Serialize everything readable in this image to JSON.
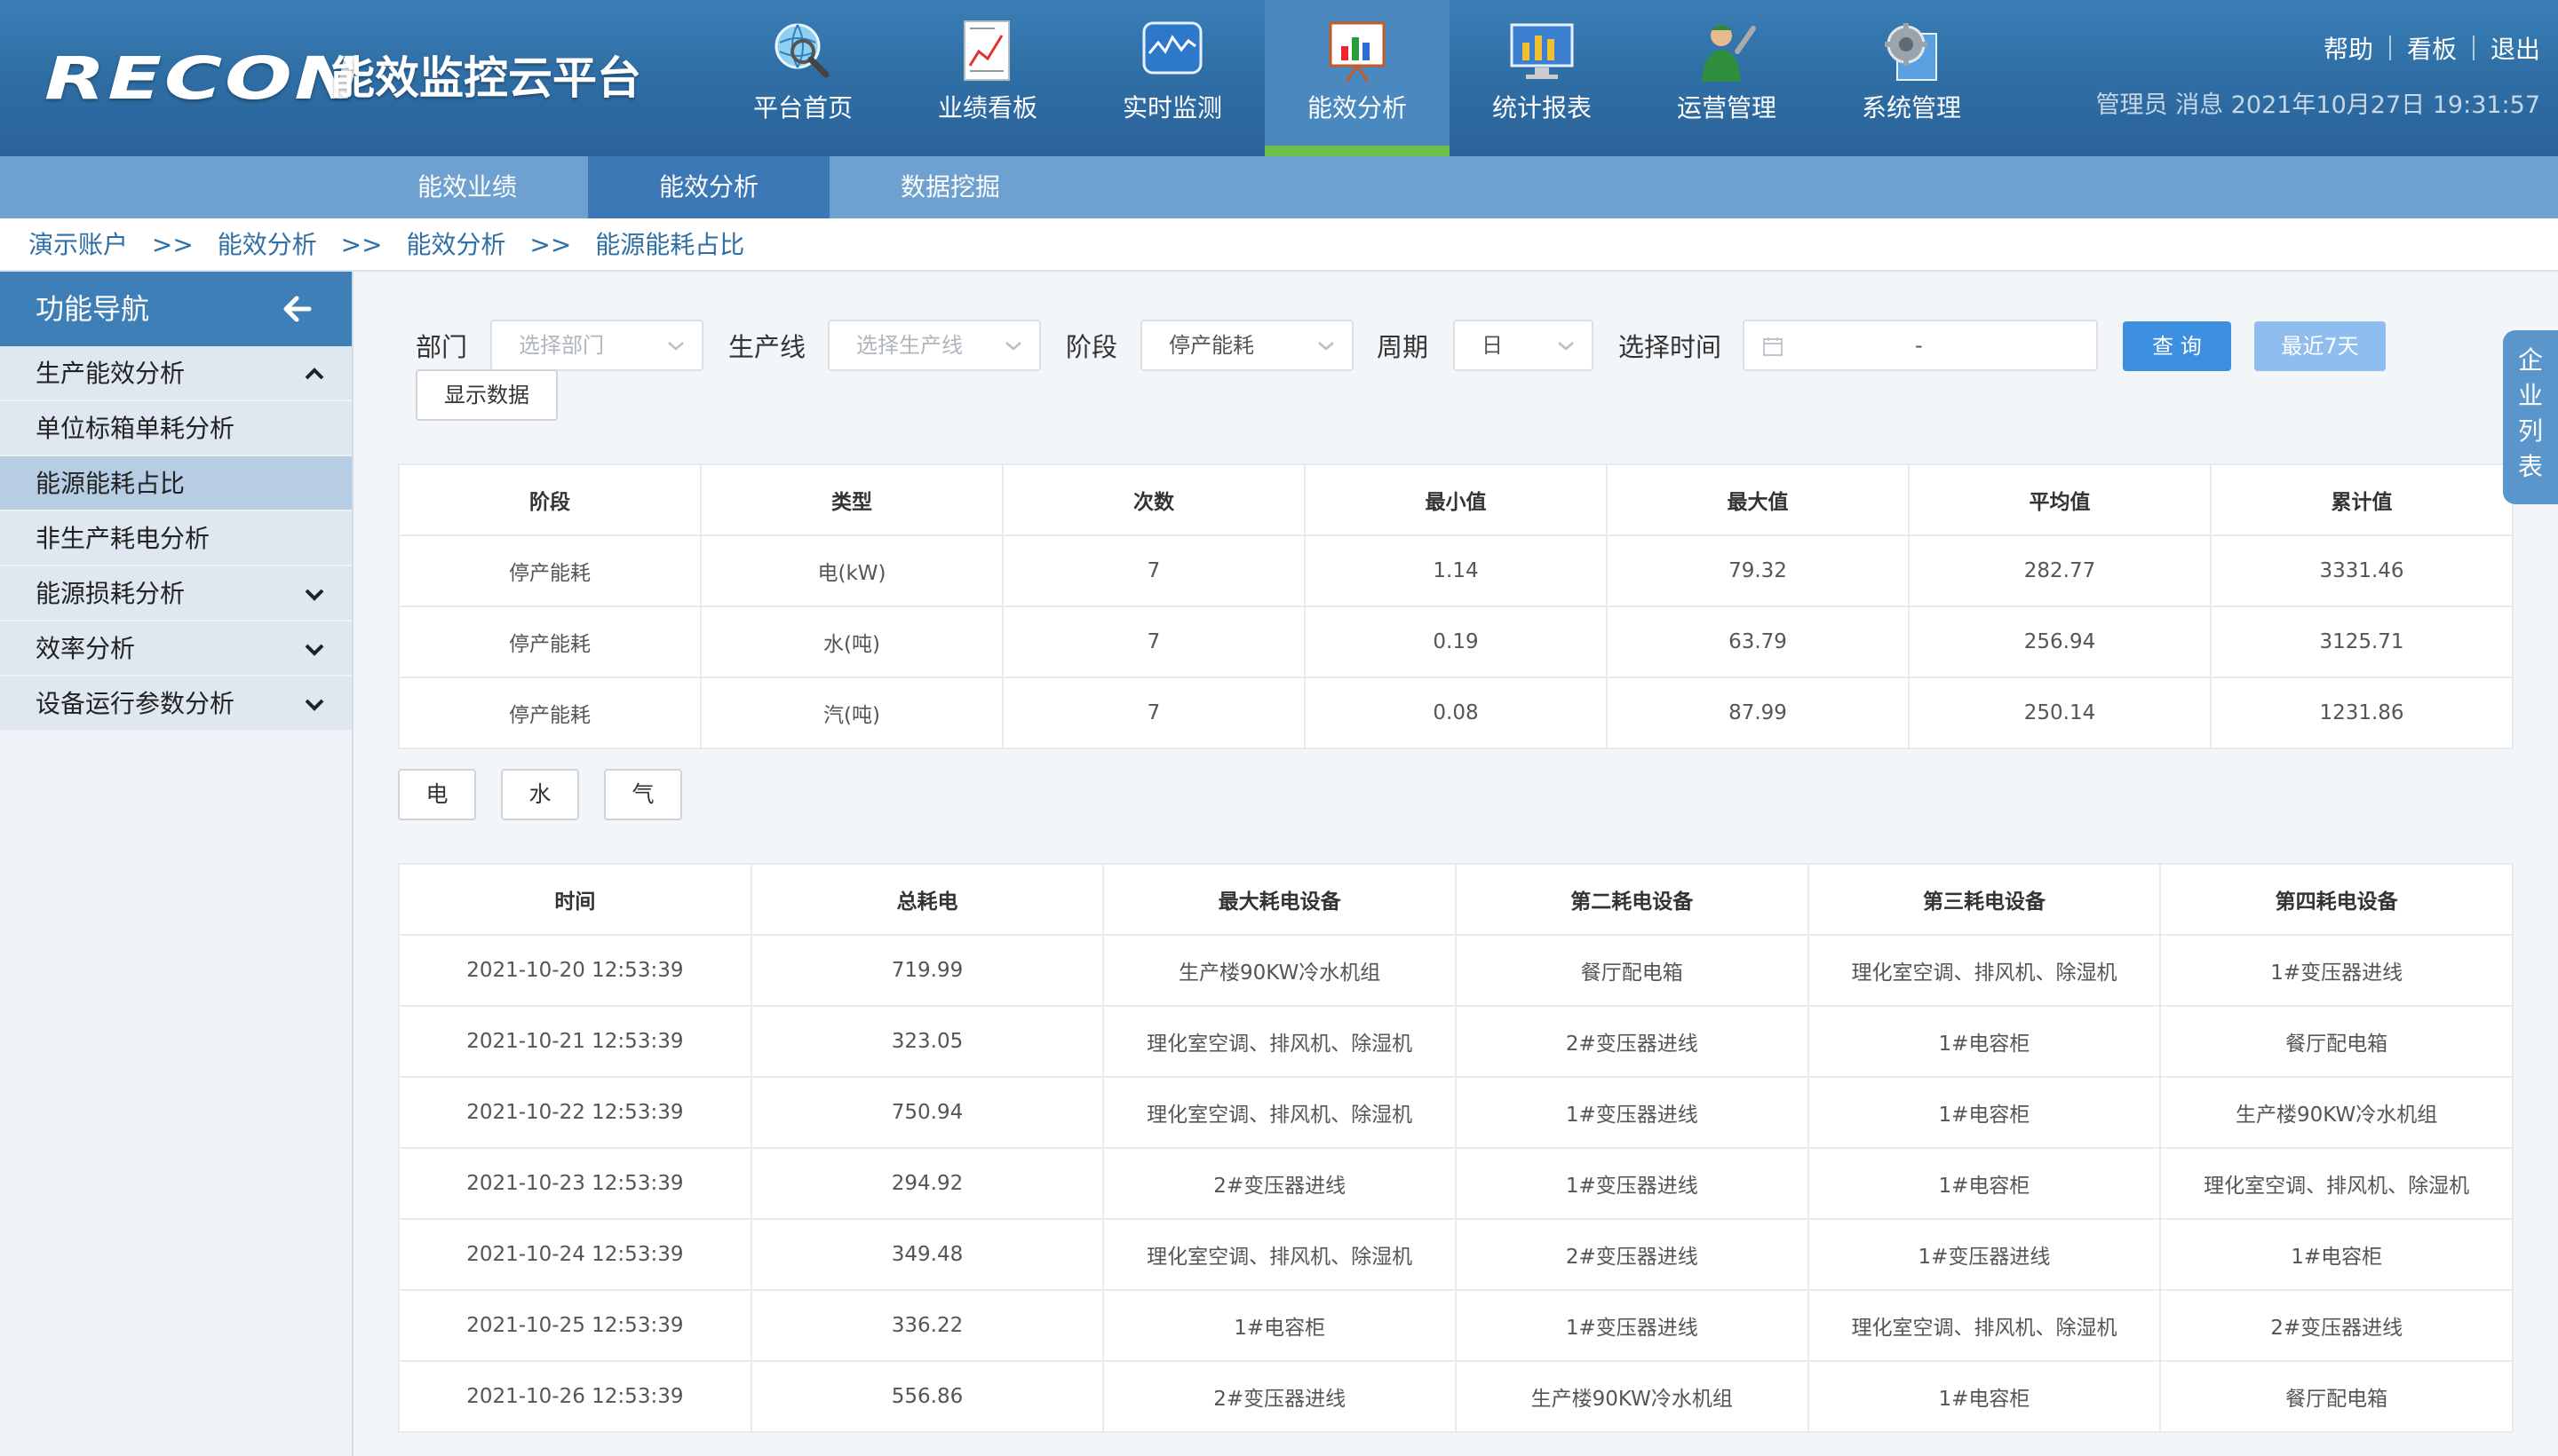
{
  "header": {
    "brand": "RECON",
    "platform": "能效监控云平台",
    "nav": [
      {
        "label": "平台首页",
        "icon": "globe-search-icon"
      },
      {
        "label": "业绩看板",
        "icon": "report-chart-icon"
      },
      {
        "label": "实时监测",
        "icon": "monitor-wave-icon"
      },
      {
        "label": "能效分析",
        "icon": "bar-chart-board-icon"
      },
      {
        "label": "统计报表",
        "icon": "screen-bar-icon"
      },
      {
        "label": "运营管理",
        "icon": "worker-wrench-icon"
      },
      {
        "label": "系统管理",
        "icon": "gear-document-icon"
      }
    ],
    "active_nav": "能效分析",
    "links": {
      "help": "帮助",
      "board": "看板",
      "logout": "退出"
    },
    "info": "管理员 消息 2021年10月27日 19:31:57"
  },
  "subnav": {
    "items": [
      "能效业绩",
      "能效分析",
      "数据挖掘"
    ],
    "active": "能效分析"
  },
  "breadcrumb": {
    "items": [
      "演示账户",
      "能效分析",
      "能效分析",
      "能源能耗占比"
    ],
    "separator": ">>"
  },
  "sidebar": {
    "title": "功能导航",
    "items": [
      {
        "label": "生产能效分析",
        "chevron": "up"
      },
      {
        "label": "单位标箱单耗分析"
      },
      {
        "label": "能源能耗占比",
        "active": true
      },
      {
        "label": "非生产耗电分析"
      },
      {
        "label": "能源损耗分析",
        "chevron": "down"
      },
      {
        "label": "效率分析",
        "chevron": "down"
      },
      {
        "label": "设备运行参数分析",
        "chevron": "down"
      }
    ]
  },
  "right_tab": "企业列表",
  "filters": {
    "department_label": "部门",
    "department_placeholder": "选择部门",
    "line_label": "生产线",
    "line_placeholder": "选择生产线",
    "stage_label": "阶段",
    "stage_value": "停产能耗",
    "period_label": "周期",
    "period_value": "日",
    "time_label": "选择时间",
    "time_separator": "-",
    "query_button": "查 询",
    "recent7_button": "最近7天",
    "show_data_button": "显示数据"
  },
  "summary_table": {
    "headers": [
      "阶段",
      "类型",
      "次数",
      "最小值",
      "最大值",
      "平均值",
      "累计值"
    ],
    "rows": [
      [
        "停产能耗",
        "电(kW)",
        "7",
        "1.14",
        "79.32",
        "282.77",
        "3331.46"
      ],
      [
        "停产能耗",
        "水(吨)",
        "7",
        "0.19",
        "63.79",
        "256.94",
        "3125.71"
      ],
      [
        "停产能耗",
        "汽(吨)",
        "7",
        "0.08",
        "87.99",
        "250.14",
        "1231.86"
      ]
    ]
  },
  "energy_tabs": [
    "电",
    "水",
    "气"
  ],
  "detail_table": {
    "headers": [
      "时间",
      "总耗电",
      "最大耗电设备",
      "第二耗电设备",
      "第三耗电设备",
      "第四耗电设备"
    ],
    "rows": [
      [
        "2021-10-20 12:53:39",
        "719.99",
        "生产楼90KW冷水机组",
        "餐厅配电箱",
        "理化室空调、排风机、除湿机",
        "1#变压器进线"
      ],
      [
        "2021-10-21 12:53:39",
        "323.05",
        "理化室空调、排风机、除湿机",
        "2#变压器进线",
        "1#电容柜",
        "餐厅配电箱"
      ],
      [
        "2021-10-22 12:53:39",
        "750.94",
        "理化室空调、排风机、除湿机",
        "1#变压器进线",
        "1#电容柜",
        "生产楼90KW冷水机组"
      ],
      [
        "2021-10-23 12:53:39",
        "294.92",
        "2#变压器进线",
        "1#变压器进线",
        "1#电容柜",
        "理化室空调、排风机、除湿机"
      ],
      [
        "2021-10-24 12:53:39",
        "349.48",
        "理化室空调、排风机、除湿机",
        "2#变压器进线",
        "1#变压器进线",
        "1#电容柜"
      ],
      [
        "2021-10-25 12:53:39",
        "336.22",
        "1#电容柜",
        "1#变压器进线",
        "理化室空调、排风机、除湿机",
        "2#变压器进线"
      ],
      [
        "2021-10-26 12:53:39",
        "556.86",
        "2#变压器进线",
        "生产楼90KW冷水机组",
        "1#电容柜",
        "餐厅配电箱"
      ]
    ]
  },
  "colors": {
    "header_bg": "#2f6fa6",
    "subnav_bg": "#6ea1cf",
    "accent_green": "#6cc04a",
    "primary_button": "#3d8fe0"
  }
}
